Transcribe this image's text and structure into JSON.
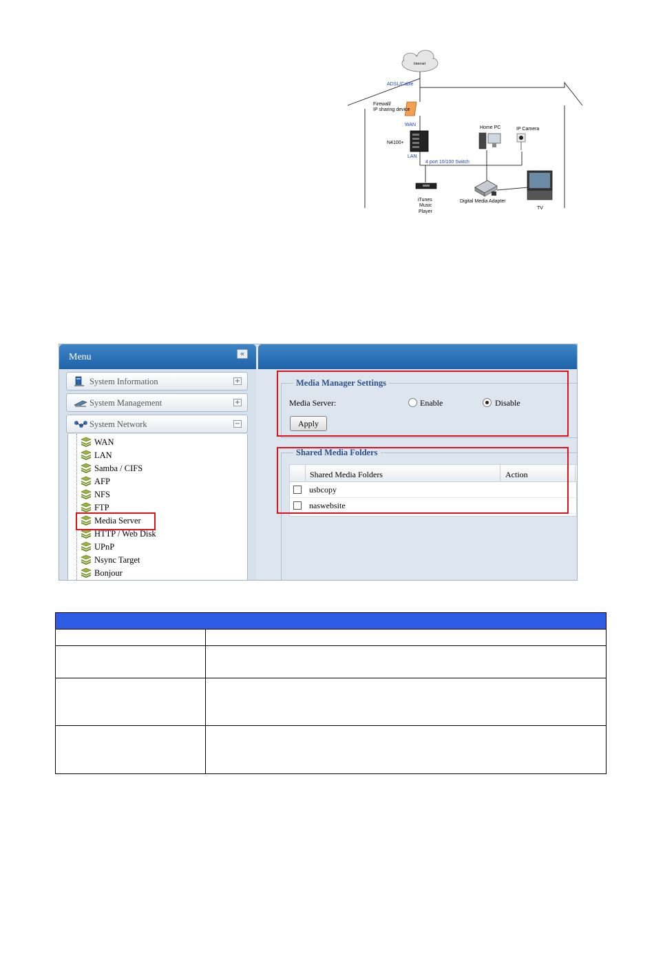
{
  "diagram": {
    "internet": "Internet",
    "adsl_cable": "ADSL/Cable",
    "firewall_line1": "Firewall/",
    "firewall_line2": "IP sharing device",
    "wan": "WAN",
    "n4100": "N4100+",
    "lan": "LAN",
    "switch": "4 port 10/100 Switch",
    "home_pc": "Home PC",
    "ip_camera": "IP Camera",
    "itunes_line1": "iTunes",
    "itunes_line2": "Music",
    "itunes_line3": "Player",
    "dma": "Digital Media Adapter",
    "tv": "TV"
  },
  "ui": {
    "menu": {
      "title": "Menu",
      "collapse_glyph": "«",
      "sections": [
        {
          "label": "System Information",
          "toggle": "+"
        },
        {
          "label": "System Management",
          "toggle": "+"
        },
        {
          "label": "System Network",
          "toggle": "−"
        }
      ],
      "items": [
        "WAN",
        "LAN",
        "Samba / CIFS",
        "AFP",
        "NFS",
        "FTP",
        "Media Server",
        "HTTP / Web Disk",
        "UPnP",
        "Nsync Target",
        "Bonjour"
      ],
      "selected_item": "Media Server"
    },
    "settings": {
      "legend": "Media Manager Settings",
      "media_server_label": "Media Server:",
      "enable_label": "Enable",
      "disable_label": "Disable",
      "selected": "Disable",
      "apply_label": "Apply"
    },
    "folders": {
      "legend": "Shared Media Folders",
      "columns": [
        "Shared Media Folders",
        "Action"
      ],
      "rows": [
        "usbcopy",
        "naswebsite"
      ]
    },
    "colors": {
      "header_blue": "#1f62a8",
      "highlight_red": "#e0101a",
      "table_header_blue": "#2d5be3"
    }
  }
}
